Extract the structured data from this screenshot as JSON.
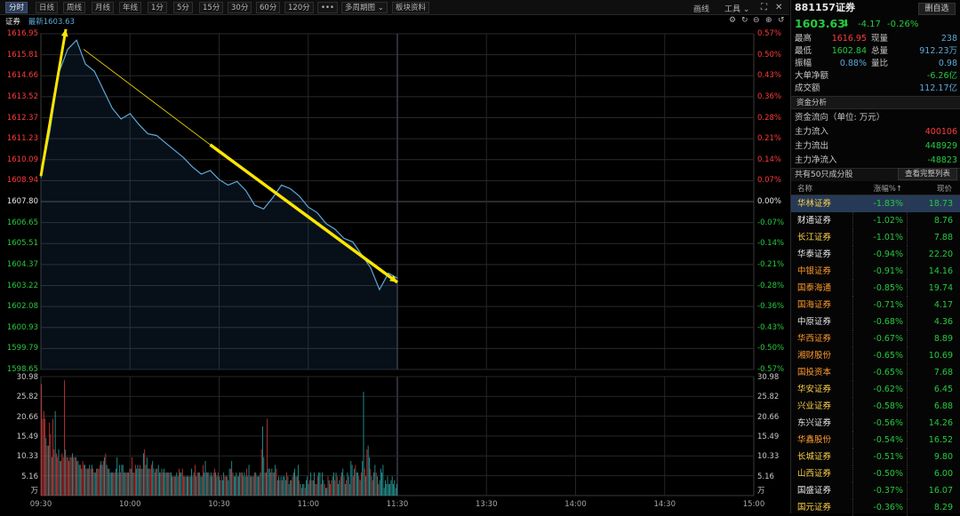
{
  "toolbar": {
    "tabs": [
      "分时",
      "日线",
      "周线",
      "月线",
      "年线",
      "1分",
      "5分",
      "15分",
      "30分",
      "60分",
      "120分",
      "•••",
      "多周期图 ⌄",
      "板块资料"
    ],
    "draw_label": "画线",
    "tools_label": "工具 ⌄"
  },
  "chart_info": {
    "name": "证券",
    "latest_label": "最新",
    "latest_value": "1603.63"
  },
  "colors": {
    "up": "#ff3b3b",
    "down": "#27c93f",
    "line": "#5fa8d8",
    "annotation": "#ffe600",
    "flat": "#e8e8e8"
  },
  "chart_data": [
    {
      "type": "line",
      "xlim": [
        "09:30",
        "15:00"
      ],
      "x_ticks": [
        "09:30",
        "10:00",
        "10:30",
        "11:00",
        "11:30",
        "13:30",
        "14:00",
        "14:30",
        "15:00"
      ],
      "ylim": [
        1598.65,
        1616.95
      ],
      "y_ticks": [
        "1616.95",
        "1615.81",
        "1614.66",
        "1613.52",
        "1612.37",
        "1611.23",
        "1610.09",
        "1608.94",
        "1607.80",
        "1606.65",
        "1605.51",
        "1604.37",
        "1603.22",
        "1602.08",
        "1600.93",
        "1599.79",
        "1598.65"
      ],
      "pct_ticks": [
        "0.57%",
        "0.50%",
        "0.43%",
        "0.36%",
        "0.28%",
        "0.21%",
        "0.14%",
        "0.07%",
        "0.00%",
        "-0.07%",
        "-0.14%",
        "-0.21%",
        "-0.28%",
        "-0.36%",
        "-0.43%",
        "-0.50%",
        "-0.57%"
      ],
      "prev_close": 1607.8,
      "x": [
        "09:30",
        "09:33",
        "09:36",
        "09:39",
        "09:42",
        "09:45",
        "09:48",
        "09:51",
        "09:54",
        "09:57",
        "10:00",
        "10:03",
        "10:06",
        "10:09",
        "10:12",
        "10:15",
        "10:18",
        "10:21",
        "10:24",
        "10:27",
        "10:30",
        "10:33",
        "10:36",
        "10:39",
        "10:42",
        "10:45",
        "10:48",
        "10:51",
        "10:54",
        "10:57",
        "11:00",
        "11:03",
        "11:06",
        "11:09",
        "11:12",
        "11:15",
        "11:18",
        "11:21",
        "11:24",
        "11:27",
        "11:30"
      ],
      "values": [
        1609.1,
        1611.6,
        1614.8,
        1616.1,
        1616.6,
        1615.3,
        1614.9,
        1613.9,
        1612.9,
        1612.3,
        1612.6,
        1612.0,
        1611.5,
        1611.4,
        1611.0,
        1610.6,
        1610.2,
        1609.7,
        1609.3,
        1609.5,
        1609.0,
        1608.7,
        1608.9,
        1608.4,
        1607.6,
        1607.4,
        1608.0,
        1608.7,
        1608.5,
        1608.1,
        1607.5,
        1607.2,
        1606.6,
        1606.3,
        1605.8,
        1605.6,
        1604.9,
        1604.2,
        1603.0,
        1603.9,
        1603.63
      ]
    },
    {
      "type": "bar",
      "ylim": [
        0,
        30.98
      ],
      "y_ticks": [
        "30.98",
        "25.82",
        "20.66",
        "15.49",
        "10.33",
        "5.16"
      ],
      "unit": "万",
      "values": [
        29,
        20,
        22,
        20,
        15,
        13,
        13,
        19,
        16,
        10,
        20,
        12,
        22,
        11,
        10,
        12,
        9,
        9,
        11,
        10,
        30,
        12,
        10,
        10,
        9,
        10,
        10,
        11,
        10,
        10,
        10,
        9,
        9,
        8,
        8,
        7,
        9,
        8,
        8,
        7,
        7,
        7,
        8,
        7,
        8,
        7,
        6,
        6,
        7,
        7,
        7,
        8,
        9,
        8,
        9,
        10,
        11,
        8,
        7,
        7,
        6,
        6,
        6,
        6,
        6,
        7,
        10,
        6,
        8,
        6,
        8,
        8,
        6,
        6,
        6,
        6,
        6,
        7,
        7,
        10,
        6,
        6,
        8,
        7,
        8,
        7,
        8,
        7,
        7,
        11,
        12,
        8,
        10,
        7,
        7,
        7,
        8,
        9,
        7,
        6,
        7,
        7,
        8,
        6,
        6,
        7,
        6,
        7,
        6,
        6,
        6,
        6,
        6,
        6,
        5,
        5,
        5,
        5,
        6,
        5,
        7,
        6,
        6,
        7,
        5,
        5,
        5,
        5,
        5,
        5,
        5,
        7,
        5,
        6,
        8,
        5,
        6,
        6,
        6,
        5,
        5,
        8,
        6,
        9,
        6,
        6,
        6,
        5,
        6,
        5,
        6,
        7,
        6,
        5,
        6,
        5,
        4,
        5,
        4,
        6,
        5,
        5,
        5,
        4,
        7,
        7,
        9,
        6,
        5,
        5,
        6,
        5,
        5,
        6,
        6,
        6,
        5,
        6,
        5,
        7,
        5,
        8,
        5,
        5,
        5,
        5,
        6,
        6,
        5,
        5,
        5,
        6,
        12,
        18,
        10,
        6,
        6,
        20,
        7,
        7,
        6,
        7,
        6,
        6,
        8,
        7,
        4,
        5,
        4,
        5,
        4,
        5,
        5,
        4,
        6,
        5,
        3,
        4,
        4,
        5,
        6,
        7,
        5,
        5,
        8,
        4,
        3,
        2,
        3,
        3,
        2,
        4,
        5,
        3,
        4,
        6,
        4,
        4,
        6,
        3,
        3,
        5,
        6,
        6,
        3,
        6,
        4,
        3,
        2,
        2,
        5,
        4,
        3,
        4,
        5,
        6,
        4,
        6,
        5,
        3,
        4,
        5,
        6,
        7,
        5,
        3,
        4,
        6,
        5,
        3,
        9,
        8,
        5,
        7,
        8,
        6,
        6,
        5,
        4,
        6,
        9,
        27,
        7,
        5,
        12,
        13,
        10,
        7,
        5,
        4,
        6,
        8,
        6,
        5,
        3,
        4,
        7,
        6,
        8,
        2,
        4,
        3,
        5,
        3,
        3,
        4,
        5,
        3,
        4,
        2,
        3
      ],
      "up_pattern": [
        1,
        1,
        1,
        1,
        0,
        1,
        0,
        1,
        1,
        0,
        1,
        1,
        0,
        1,
        1,
        0,
        1,
        0,
        1,
        1,
        1,
        0,
        1,
        1,
        1,
        0,
        1,
        0,
        1,
        1,
        0,
        1,
        0,
        0,
        1,
        0,
        1,
        1,
        0,
        1,
        0,
        1,
        0,
        1,
        0,
        1,
        0,
        0,
        1,
        0,
        1,
        1,
        0,
        0,
        1,
        0,
        1,
        0,
        1,
        0,
        0,
        0,
        1,
        0,
        1,
        0,
        0,
        1,
        0,
        1,
        0,
        0,
        1,
        0,
        0,
        1,
        0,
        1,
        0,
        1,
        0,
        1,
        1,
        0,
        0,
        0,
        1,
        0,
        1,
        0,
        1,
        0,
        0,
        1,
        0,
        1,
        1,
        0,
        0,
        1,
        0,
        1,
        0,
        0,
        1,
        0,
        1,
        0,
        0,
        0,
        1,
        0,
        1,
        0,
        0,
        1,
        0,
        1,
        0,
        0,
        1,
        0,
        0,
        1,
        1,
        0,
        1,
        0,
        0,
        1,
        0,
        0,
        1,
        0,
        1,
        0,
        1,
        0,
        1,
        0,
        0,
        1,
        0,
        0,
        0,
        1,
        0,
        1,
        0,
        0,
        1,
        1,
        0,
        0,
        1,
        0,
        0,
        1,
        0,
        0,
        1,
        0,
        1,
        0,
        0,
        1,
        0,
        1,
        0,
        0,
        0,
        1,
        0,
        0,
        1,
        0,
        1,
        0,
        0,
        1,
        0,
        0,
        1,
        0,
        1,
        0,
        1,
        0,
        0,
        0,
        1,
        0,
        1,
        0,
        0,
        1,
        0,
        1,
        0,
        0,
        1,
        0,
        0,
        1,
        0,
        1,
        0,
        0,
        1,
        0,
        1,
        0,
        0,
        0,
        1,
        0,
        0,
        1,
        0,
        1,
        0,
        0,
        1,
        0,
        0,
        1,
        0,
        1,
        0,
        0,
        1,
        0,
        0,
        0,
        1,
        0,
        1,
        0,
        0,
        1,
        0,
        1,
        0,
        0,
        1,
        0,
        0,
        1,
        0,
        0,
        1,
        0,
        1,
        1,
        0,
        0,
        1,
        0,
        1,
        0,
        0,
        1,
        0,
        0,
        1,
        0,
        1,
        0,
        0,
        1,
        0,
        0,
        1,
        0,
        1,
        0,
        0,
        1,
        0,
        1,
        0,
        0,
        1,
        0,
        1,
        0,
        0,
        1,
        0,
        1,
        0,
        0,
        1,
        0,
        1,
        0
      ]
    }
  ],
  "quote": {
    "code": "881157",
    "name": "证券",
    "add_label": "删自选",
    "price": "1603.63",
    "arrow": "⬇",
    "change": "-4.17",
    "change_pct": "-0.26%",
    "stats": [
      {
        "k": "最高",
        "v": "1616.95",
        "k2": "现量",
        "v2": "238",
        "c1": "up",
        "c2": "blue"
      },
      {
        "k": "最低",
        "v": "1602.84",
        "k2": "总量",
        "v2": "912.23万",
        "c1": "down",
        "c2": "blue"
      },
      {
        "k": "振幅",
        "v": "0.88%",
        "k2": "量比",
        "v2": "0.98",
        "c1": "blue",
        "c2": "blue"
      }
    ],
    "big_net_label": "大单净额",
    "big_net_value": "-6.26亿",
    "turnover_label": "成交额",
    "turnover_value": "112.17亿"
  },
  "fund": {
    "section_title": "资金分析",
    "subtitle": "资金流向（单位: 万元）",
    "items": [
      {
        "k": "主力流入",
        "v": "400106",
        "c": "up"
      },
      {
        "k": "主力流出",
        "v": "448929",
        "c": "down"
      },
      {
        "k": "主力净流入",
        "v": "-48823",
        "c": "down"
      }
    ]
  },
  "components": {
    "count_text": "共有50只成分股",
    "view_all": "查看完整列表",
    "headers": [
      "名称",
      "涨幅%↑",
      "现价"
    ],
    "rows": [
      {
        "name": "华林证券",
        "pct": "-1.83%",
        "price": "18.73",
        "nc": "#ffd24a"
      },
      {
        "name": "财通证券",
        "pct": "-1.02%",
        "price": "8.76",
        "nc": "#e8e8e8"
      },
      {
        "name": "长江证券",
        "pct": "-1.01%",
        "price": "7.88",
        "nc": "#ffd24a"
      },
      {
        "name": "华泰证券",
        "pct": "-0.94%",
        "price": "22.20",
        "nc": "#e8e8e8"
      },
      {
        "name": "中银证券",
        "pct": "-0.91%",
        "price": "14.16",
        "nc": "#ff9a2e"
      },
      {
        "name": "国泰海通",
        "pct": "-0.85%",
        "price": "19.74",
        "nc": "#ff9a2e"
      },
      {
        "name": "国海证券",
        "pct": "-0.71%",
        "price": "4.17",
        "nc": "#ff9a2e"
      },
      {
        "name": "中原证券",
        "pct": "-0.68%",
        "price": "4.36",
        "nc": "#e8e8e8"
      },
      {
        "name": "华西证券",
        "pct": "-0.67%",
        "price": "8.89",
        "nc": "#ff9a2e"
      },
      {
        "name": "湘财股份",
        "pct": "-0.65%",
        "price": "10.69",
        "nc": "#ff9a2e"
      },
      {
        "name": "国投资本",
        "pct": "-0.65%",
        "price": "7.68",
        "nc": "#ff9a2e"
      },
      {
        "name": "华安证券",
        "pct": "-0.62%",
        "price": "6.45",
        "nc": "#ffd24a"
      },
      {
        "name": "兴业证券",
        "pct": "-0.58%",
        "price": "6.88",
        "nc": "#ffd24a"
      },
      {
        "name": "东兴证券",
        "pct": "-0.56%",
        "price": "14.26",
        "nc": "#e8e8e8"
      },
      {
        "name": "华鑫股份",
        "pct": "-0.54%",
        "price": "16.52",
        "nc": "#ff9a2e"
      },
      {
        "name": "长城证券",
        "pct": "-0.51%",
        "price": "9.80",
        "nc": "#ffd24a"
      },
      {
        "name": "山西证券",
        "pct": "-0.50%",
        "price": "6.00",
        "nc": "#ffd24a"
      },
      {
        "name": "国盛证券",
        "pct": "-0.37%",
        "price": "16.07",
        "nc": "#e8e8e8"
      },
      {
        "name": "国元证券",
        "pct": "-0.36%",
        "price": "8.29",
        "nc": "#ffd24a"
      }
    ]
  }
}
